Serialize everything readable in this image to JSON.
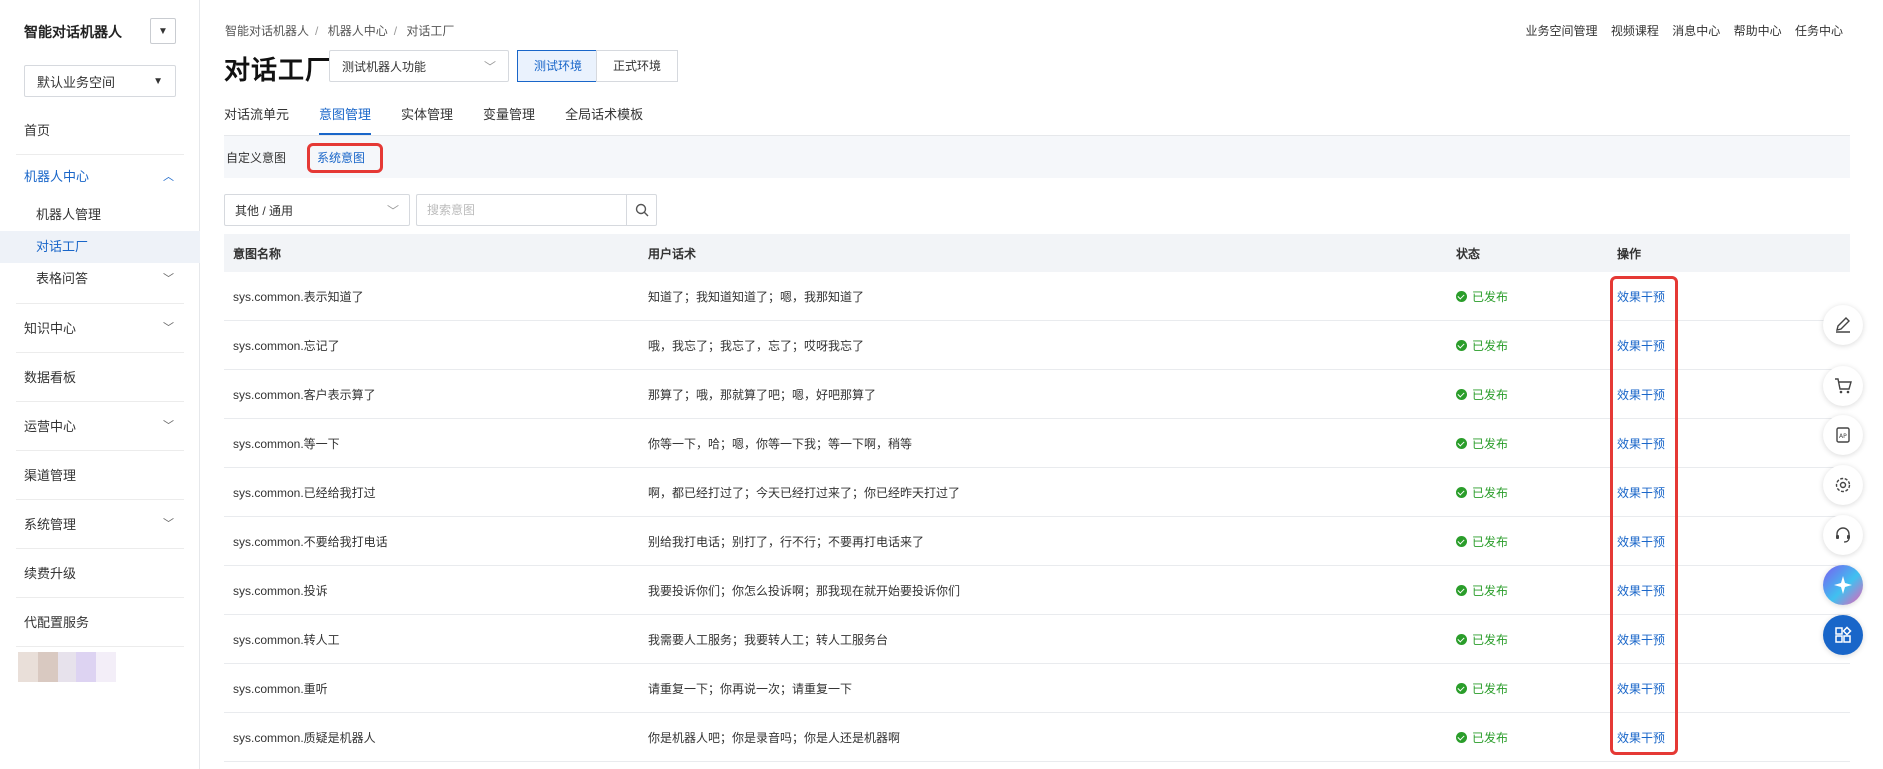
{
  "sidebar": {
    "brand": "智能对话机器人",
    "workspace": "默认业务空间",
    "items": {
      "home": "首页",
      "robot_center": "机器人中心",
      "robot_manage": "机器人管理",
      "dialog_factory": "对话工厂",
      "table_qa": "表格问答",
      "knowledge": "知识中心",
      "dashboard": "数据看板",
      "operations": "运营中心",
      "channels": "渠道管理",
      "system": "系统管理",
      "renew": "续费升级",
      "config_service": "代配置服务"
    }
  },
  "header": {
    "breadcrumb": [
      "智能对话机器人",
      "机器人中心",
      "对话工厂"
    ],
    "breadcrumb_sep": "/",
    "top_links": [
      "业务空间管理",
      "视频课程",
      "消息中心",
      "帮助中心",
      "任务中心"
    ],
    "title": "对话工厂",
    "bot_select": "测试机器人功能",
    "env_test": "测试环境",
    "env_prod": "正式环境"
  },
  "tabs": [
    "对话流单元",
    "意图管理",
    "实体管理",
    "变量管理",
    "全局话术模板"
  ],
  "subtabs": [
    "自定义意图",
    "系统意图"
  ],
  "filter": {
    "category": "其他 / 通用",
    "search_placeholder": "搜索意图"
  },
  "table": {
    "headers": [
      "意图名称",
      "用户话术",
      "状态",
      "操作"
    ],
    "rows": [
      {
        "name": "sys.common.表示知道了",
        "utterance": "知道了；我知道知道了；嗯，我那知道了",
        "status": "已发布",
        "op": "效果干预"
      },
      {
        "name": "sys.common.忘记了",
        "utterance": "哦，我忘了；我忘了，忘了；哎呀我忘了",
        "status": "已发布",
        "op": "效果干预"
      },
      {
        "name": "sys.common.客户表示算了",
        "utterance": "那算了；哦，那就算了吧；嗯，好吧那算了",
        "status": "已发布",
        "op": "效果干预"
      },
      {
        "name": "sys.common.等一下",
        "utterance": "你等一下，哈；嗯，你等一下我；等一下啊，稍等",
        "status": "已发布",
        "op": "效果干预"
      },
      {
        "name": "sys.common.已经给我打过",
        "utterance": "啊，都已经打过了；今天已经打过来了；你已经昨天打过了",
        "status": "已发布",
        "op": "效果干预"
      },
      {
        "name": "sys.common.不要给我打电话",
        "utterance": "别给我打电话；别打了，行不行；不要再打电话来了",
        "status": "已发布",
        "op": "效果干预"
      },
      {
        "name": "sys.common.投诉",
        "utterance": "我要投诉你们；你怎么投诉啊；那我现在就开始要投诉你们",
        "status": "已发布",
        "op": "效果干预"
      },
      {
        "name": "sys.common.转人工",
        "utterance": "我需要人工服务；我要转人工；转人工服务台",
        "status": "已发布",
        "op": "效果干预"
      },
      {
        "name": "sys.common.重听",
        "utterance": "请重复一下；你再说一次；请重复一下",
        "status": "已发布",
        "op": "效果干预"
      },
      {
        "name": "sys.common.质疑是机器人",
        "utterance": "你是机器人吧；你是录音吗；你是人还是机器啊",
        "status": "已发布",
        "op": "效果干预"
      }
    ]
  },
  "colors": {
    "accent": "#1966c9",
    "published": "#2a9d2a",
    "highlight": "#e53935"
  },
  "float_icons": [
    "edit-icon",
    "cart-icon",
    "api-icon",
    "settings-icon",
    "headset-icon",
    "ai-star-icon",
    "apps-icon"
  ]
}
